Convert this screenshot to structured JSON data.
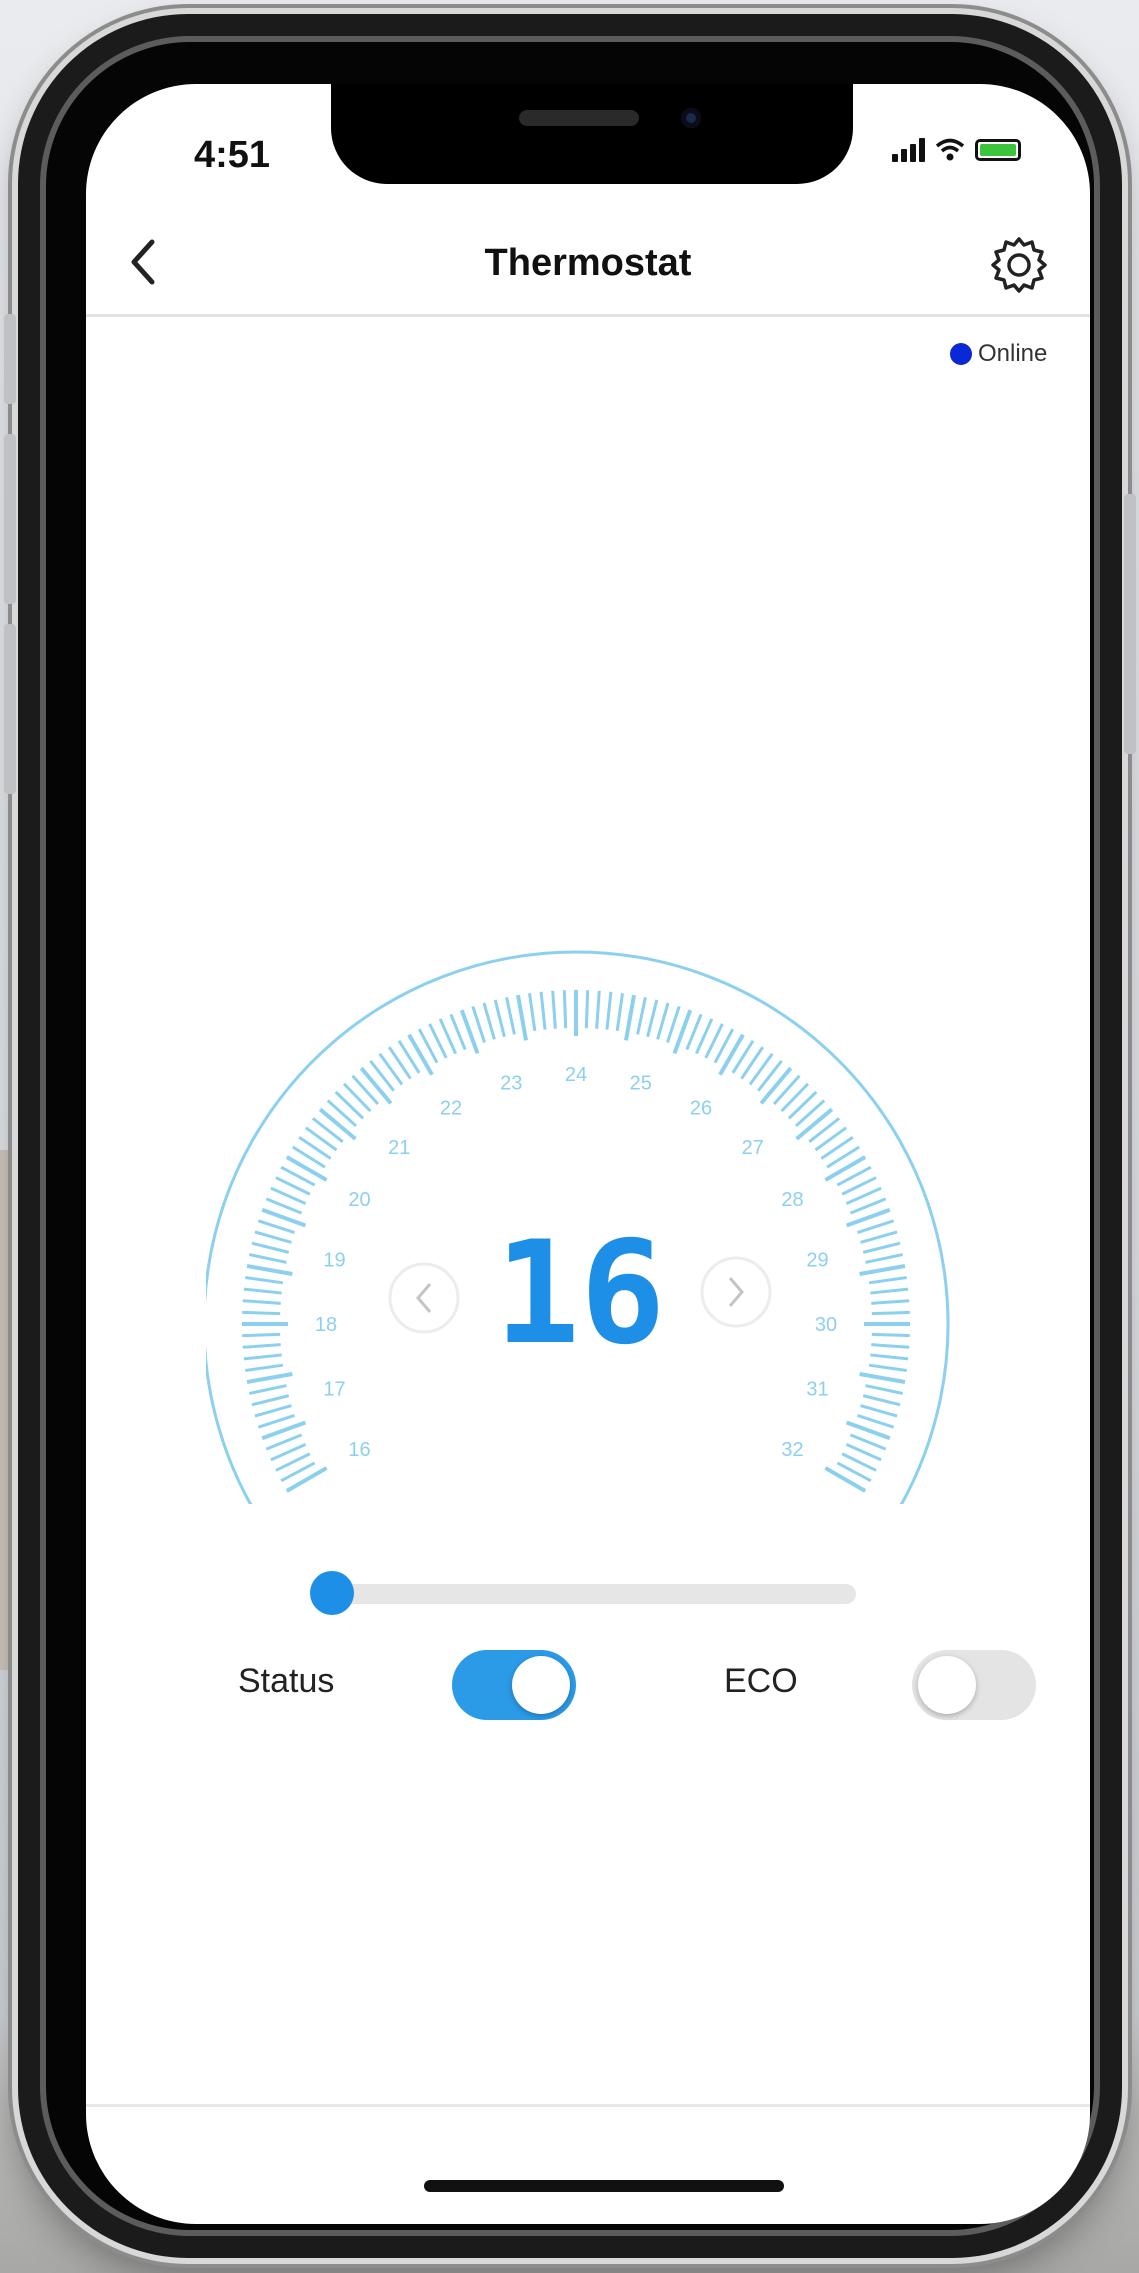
{
  "status_bar": {
    "time": "4:51"
  },
  "nav": {
    "title": "Thermostat",
    "back_icon": "chevron-left-icon",
    "settings_icon": "gear-icon"
  },
  "connection": {
    "label": "Online",
    "color": "#0a28d6"
  },
  "thermostat": {
    "setpoint": "16",
    "scale_labels": [
      "16",
      "17",
      "18",
      "19",
      "20",
      "21",
      "22",
      "23",
      "24",
      "25",
      "26",
      "27",
      "28",
      "29",
      "30",
      "31",
      "32"
    ],
    "accent_color": "#1e8fe6",
    "dial_color": "#8cd0ef"
  },
  "slider": {
    "level": 0.0
  },
  "controls": {
    "status_label": "Status",
    "status_on": true,
    "eco_label": "ECO",
    "eco_on": false
  }
}
